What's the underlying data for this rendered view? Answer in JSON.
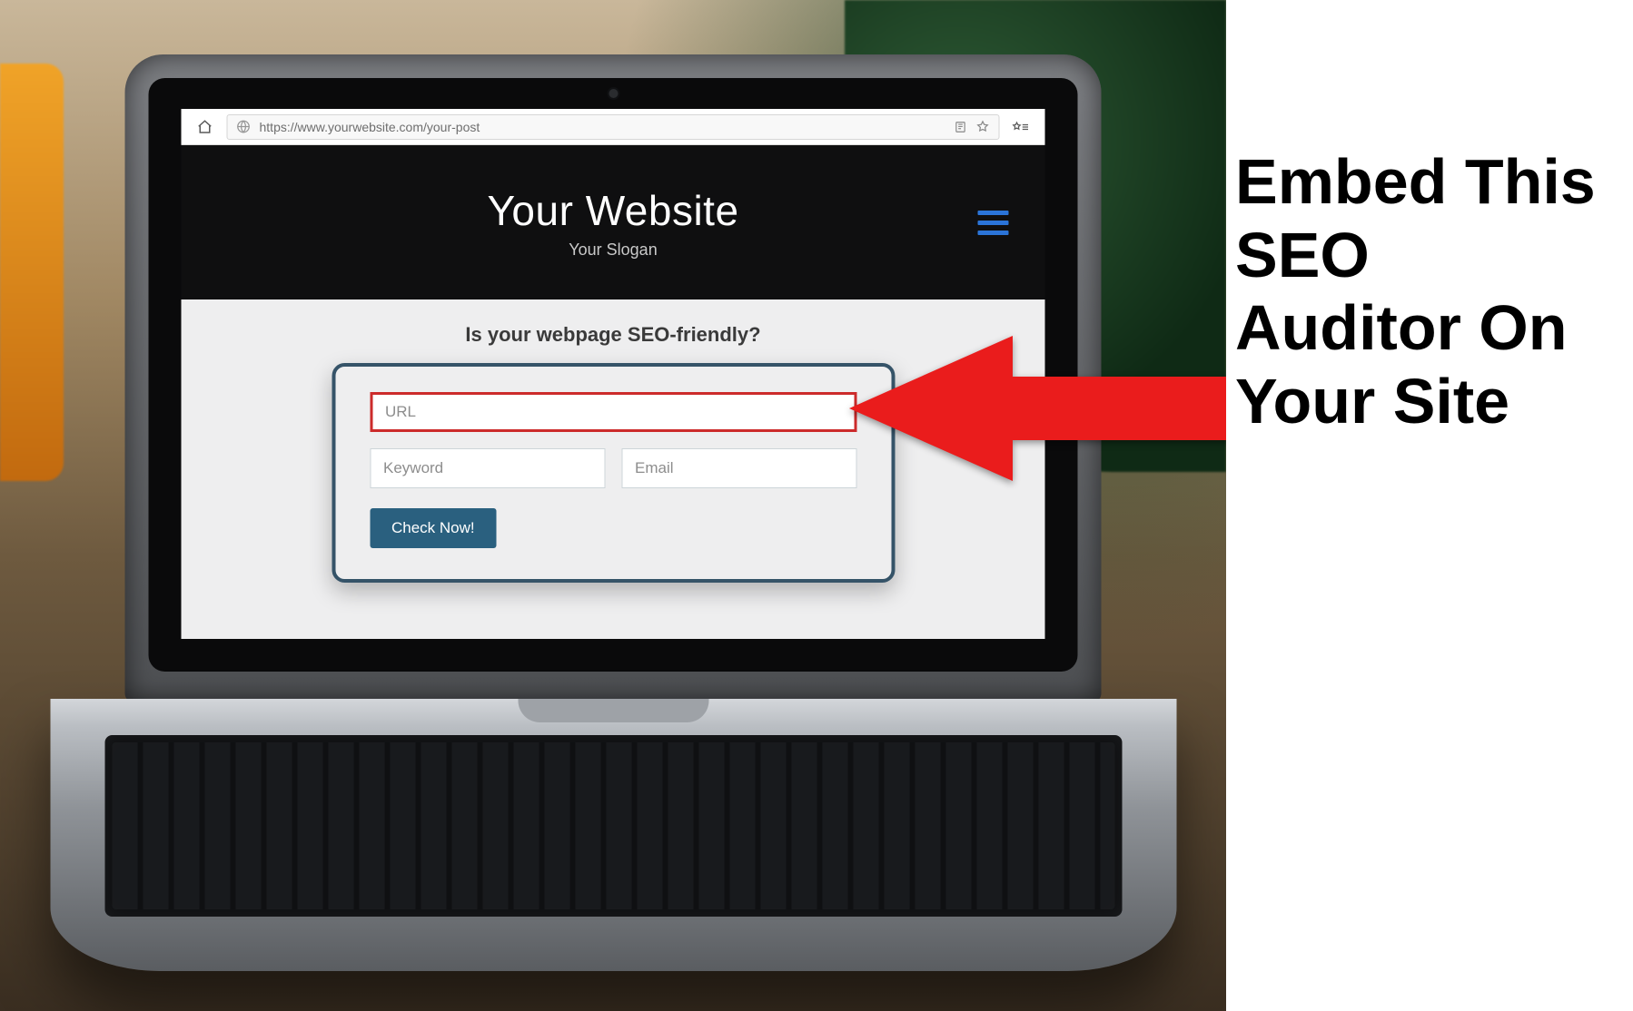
{
  "caption": {
    "text": "Embed This SEO Auditor On Your Site"
  },
  "browser": {
    "url": "https://www.yourwebsite.com/your-post"
  },
  "site": {
    "title": "Your Website",
    "slogan": "Your Slogan",
    "subheading": "Is your webpage SEO-friendly?"
  },
  "widget": {
    "url_placeholder": "URL",
    "keyword_placeholder": "Keyword",
    "email_placeholder": "Email",
    "button_label": "Check Now!"
  },
  "colors": {
    "accent_blue": "#2b74d8",
    "widget_border": "#355368",
    "url_highlight": "#cc2b2b",
    "button_bg": "#2a607f",
    "arrow": "#ea1c1c"
  }
}
